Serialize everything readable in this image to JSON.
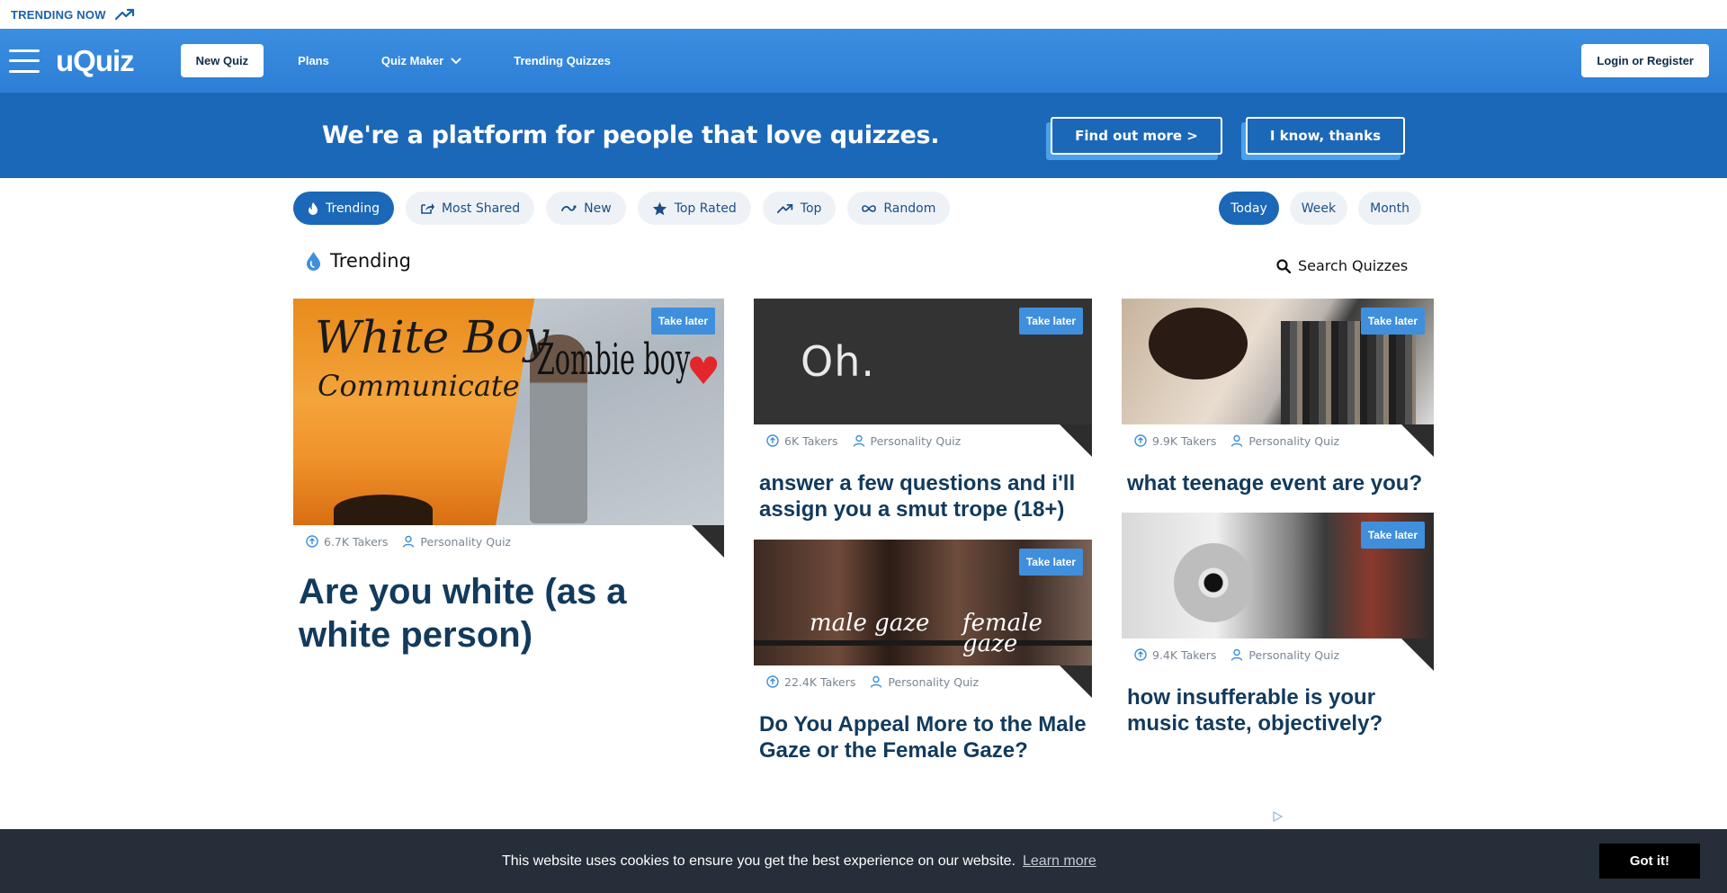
{
  "trending_strip": {
    "label": "TRENDING NOW",
    "icon": "trending-up-icon"
  },
  "nav": {
    "logo": "uQuiz",
    "new_quiz": "New Quiz",
    "plans": "Plans",
    "quiz_maker": "Quiz Maker",
    "trending_quizzes": "Trending Quizzes",
    "login": "Login or Register"
  },
  "banner": {
    "text": "We're a platform for people that love quizzes.",
    "find_out": "Find out more >",
    "i_know": "I know, thanks"
  },
  "filters": {
    "tabs": [
      {
        "label": "Trending",
        "icon": "flame-icon",
        "active": true
      },
      {
        "label": "Most Shared",
        "icon": "share-icon",
        "active": false
      },
      {
        "label": "New",
        "icon": "new-icon",
        "active": false
      },
      {
        "label": "Top Rated",
        "icon": "star-icon",
        "active": false
      },
      {
        "label": "Top",
        "icon": "trending-up-icon",
        "active": false
      },
      {
        "label": "Random",
        "icon": "shuffle-icon",
        "active": false
      }
    ],
    "periods": [
      {
        "label": "Today",
        "active": true
      },
      {
        "label": "Week",
        "active": false
      },
      {
        "label": "Month",
        "active": false
      }
    ]
  },
  "section": {
    "title": "Trending",
    "search": "Search Quizzes"
  },
  "take_later": "Take later",
  "cards": [
    {
      "title": "Are you white (as a white person)",
      "takers": "6.7K Takers",
      "type": "Personality Quiz",
      "thumb_text": [
        "White Boy",
        "Communicate",
        "Zombie boy"
      ]
    },
    {
      "title": "answer a few questions and i'll assign you a smut trope (18+)",
      "takers": "6K Takers",
      "type": "Personality Quiz",
      "thumb_text": [
        "Oh."
      ]
    },
    {
      "title": "what teenage event are you?",
      "takers": "9.9K Takers",
      "type": "Personality Quiz"
    },
    {
      "title": "Do You Appeal More to the Male Gaze or the Female Gaze?",
      "takers": "22.4K Takers",
      "type": "Personality Quiz",
      "thumb_text": [
        "male gaze",
        "female gaze"
      ]
    },
    {
      "title": "how insufferable is your music taste, objectively?",
      "takers": "9.4K Takers",
      "type": "Personality Quiz"
    }
  ],
  "cookie": {
    "message": "This website uses cookies to ensure you get the best experience on our website.",
    "learn_more": "Learn more",
    "got_it": "Got it!"
  },
  "colors": {
    "primary": "#1c68b8",
    "nav": "#3b8ee0",
    "accent": "#3f8fdc",
    "title": "#123a5c",
    "cookie_bg": "#252e39"
  }
}
